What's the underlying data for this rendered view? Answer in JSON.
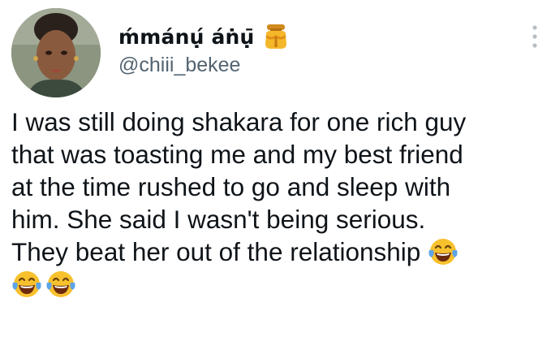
{
  "author": {
    "display_name": "ḿmánụ́ áṅụ̄",
    "handle": "@chiii_bekee",
    "avatar_icon": "profile-photo",
    "badge_icon": "honey-pot-icon"
  },
  "menu": {
    "icon": "more-vertical-icon"
  },
  "tweet": {
    "lines": [
      "I was still doing shakara for one rich guy",
      "that was toasting me and my best friend",
      "at the time rushed to go and sleep with",
      "him. She said I wasn't being serious.",
      "They beat her out of the relationship"
    ],
    "emoji_name": "face-with-tears-of-joy",
    "emoji_count_inline": 1,
    "emoji_count_trailing": 2
  },
  "colors": {
    "text": "#0f1419",
    "secondary": "#536471",
    "emoji_face": "#f7c12e",
    "emoji_tears": "#5ea4e8"
  }
}
